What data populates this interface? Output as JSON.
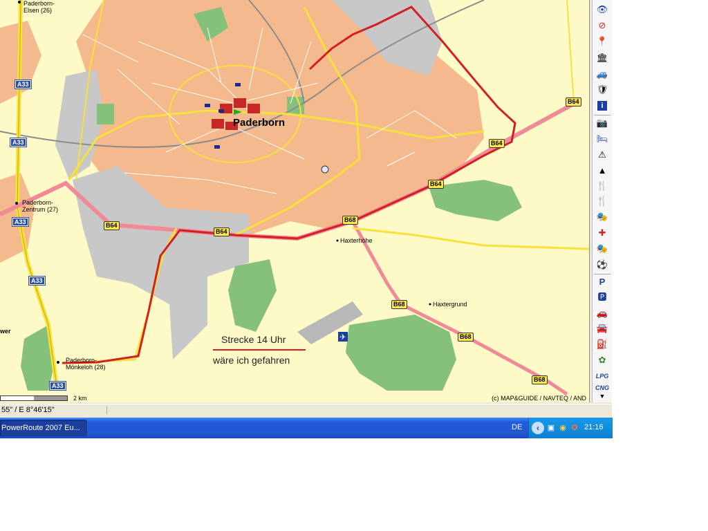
{
  "map": {
    "city": "Paderborn",
    "places": {
      "elsen": "Paderborn-\nElsen (26)",
      "zentrum": "Paderborn-\nZentrum (27)",
      "moenkeloh": "Paderborn-\nMönkeloh (28)",
      "haxterhoehe": "Haxterhöhe",
      "haxtergrund": "Haxtergrund",
      "wer": "wer"
    },
    "shields": {
      "a33": "A33",
      "b64": "B64",
      "b68": "B68"
    },
    "annotation": {
      "line1": "Strecke 14 Uhr",
      "line2": "wäre ich gefahren"
    },
    "scale_label": "2 km",
    "copyright": "(c) MAP&GUIDE / NAVTEQ / AND",
    "colors": {
      "urban": "#f5b98e",
      "industrial": "#c8c8c8",
      "forest": "#86c17c",
      "background": "#fdfac8",
      "route": "#d21f1f",
      "main_road": "#f7e23b",
      "highway": "#f08a96"
    }
  },
  "toolbar": {
    "icons": [
      "eye-icon",
      "eye-crossed-icon",
      "pin-icon",
      "museum-icon",
      "car-service-icon",
      "shield-icon",
      "info-icon",
      "camera-icon",
      "hotel-icon",
      "warning-icon",
      "hazard-icon",
      "restaurant-icon",
      "restaurant-icon-2",
      "theater-icon",
      "hospital-icon",
      "masks-icon",
      "football-icon",
      "parking-icon",
      "parking-garage-icon",
      "car-icon",
      "car-rental-icon",
      "fuel-icon",
      "flower-icon",
      "lpg-icon",
      "cng-icon"
    ],
    "lpg_label": "LPG",
    "cng_label": "CNG",
    "info_label": "i"
  },
  "status": {
    "coords": "55\" / E 8°46'15\""
  },
  "taskbar": {
    "app_button": "PowerRoute 2007 Eu...",
    "language": "DE",
    "clock": "21:16"
  }
}
